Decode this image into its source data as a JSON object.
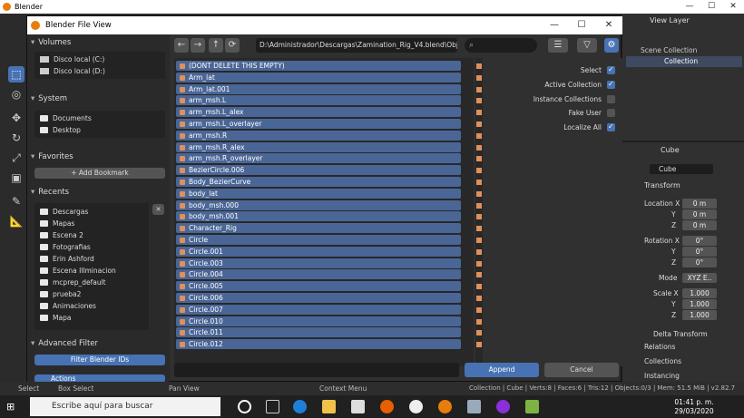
{
  "app": {
    "title": "Blender",
    "window_controls": [
      "—",
      "☐",
      "✕"
    ]
  },
  "dialog": {
    "title": "Blender File View",
    "controls": [
      "—",
      "☐",
      "✕"
    ]
  },
  "sidebar": {
    "volumes": {
      "title": "Volumes",
      "items": [
        "Disco local (C:)",
        "Disco local (D:)"
      ]
    },
    "system": {
      "title": "System",
      "items": [
        "Documents",
        "Desktop"
      ]
    },
    "favorites": {
      "title": "Favorites",
      "add_bookmark": "+ Add Bookmark"
    },
    "recents": {
      "title": "Recents",
      "items": [
        "Descargas",
        "Mapas",
        "Escena 2",
        "Fotografias",
        "Erin Ashford",
        "Escena Illminacion",
        "mcprep_default",
        "prueba2",
        "Animaciones",
        "Mapa"
      ],
      "close": "✕"
    },
    "advanced_filter": {
      "title": "Advanced Filter",
      "filter_ids": "Filter Blender IDs",
      "actions": "Actions"
    }
  },
  "nav": {
    "back": "←",
    "forward": "→",
    "parent": "↑",
    "refresh": "⟳",
    "path": "D:\\Administrador\\Descargas\\Zamination_Rig_V4.blend\\Object\\",
    "search_icon": "⌕"
  },
  "files": [
    "(DONT DELETE THIS EMPTY)",
    "Arm_lat",
    "Arm_lat.001",
    "arm_msh.L",
    "arm_msh.L_alex",
    "arm_msh.L_overlayer",
    "arm_msh.R",
    "arm_msh.R_alex",
    "arm_msh.R_overlayer",
    "BezierCircle.006",
    "Body_BezierCurve",
    "body_lat",
    "body_msh.000",
    "body_msh.001",
    "Character_Rig",
    "Circle",
    "Circle.001",
    "Circle.003",
    "Circle.004",
    "Circle.005",
    "Circle.006",
    "Circle.007",
    "Circle.010",
    "Circle.011",
    "Circle.012"
  ],
  "options": [
    {
      "label": "Select",
      "checked": true
    },
    {
      "label": "Active Collection",
      "checked": true
    },
    {
      "label": "Instance Collections",
      "checked": false
    },
    {
      "label": "Fake User",
      "checked": false
    },
    {
      "label": "Localize All",
      "checked": true
    }
  ],
  "footer": {
    "append": "Append",
    "cancel": "Cancel"
  },
  "outliner": {
    "view_layer": "View Layer",
    "scene_collection": "Scene Collection",
    "collection": "Collection"
  },
  "properties": {
    "object_name": "Cube",
    "object_field": "Cube",
    "transform": "Transform",
    "location": {
      "label": "Location X",
      "x": "0 m",
      "y": "0 m",
      "z": "0 m"
    },
    "rotation": {
      "label": "Rotation X",
      "x": "0°",
      "y": "0°",
      "z": "0°"
    },
    "mode": {
      "label": "Mode",
      "value": "XYZ E.."
    },
    "scale": {
      "label": "Scale X",
      "x": "1.000",
      "y": "1.000",
      "z": "1.000"
    },
    "y": "Y",
    "z": "Z",
    "delta": "Delta Transform",
    "relations": "Relations",
    "collections": "Collections",
    "instancing": "Instancing"
  },
  "status": {
    "select": "Select",
    "box_select": "Box Select",
    "pan_view": "Pan View",
    "context_menu": "Context Menu",
    "info": "Collection | Cube | Verts:8 | Faces:6 | Tris:12 | Objects:0/3 | Mem: 51.5 MiB | v2.82.7"
  },
  "taskbar": {
    "search": "Escribe aquí para buscar",
    "time": "01:41 p. m.",
    "date": "29/03/2020"
  }
}
